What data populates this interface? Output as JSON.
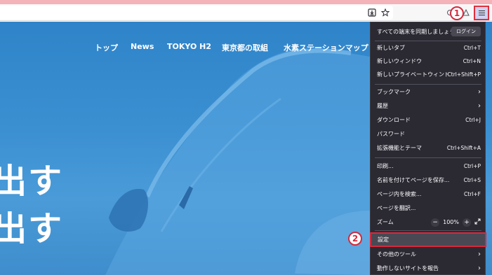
{
  "toolbar": {
    "download_icon": "download-icon",
    "bookmark_icon": "star-icon",
    "menu_icon": "hamburger-menu-icon"
  },
  "markers": {
    "one": "1",
    "two": "2"
  },
  "site_nav": {
    "items": [
      "トップ",
      "News",
      "TOKYO H2",
      "東京都の取組",
      "水素ステーションマップ"
    ]
  },
  "hero": {
    "line1": "出す",
    "line2": "出す"
  },
  "menu": {
    "sync_label": "すべての端末を同期しましょう",
    "sync_button": "ログイン",
    "new_tab": "新しいタブ",
    "new_tab_shortcut": "Ctrl+T",
    "new_window": "新しいウィンドウ",
    "new_window_shortcut": "Ctrl+N",
    "new_private": "新しいプライベートウィンドウ",
    "new_private_shortcut": "Ctrl+Shift+P",
    "bookmarks": "ブックマーク",
    "history": "履歴",
    "downloads": "ダウンロード",
    "downloads_shortcut": "Ctrl+J",
    "passwords": "パスワード",
    "addons": "拡張機能とテーマ",
    "addons_shortcut": "Ctrl+Shift+A",
    "print": "印刷...",
    "print_shortcut": "Ctrl+P",
    "save_page": "名前を付けてページを保存...",
    "save_page_shortcut": "Ctrl+S",
    "find": "ページ内を検索...",
    "find_shortcut": "Ctrl+F",
    "translate": "ページを翻訳...",
    "zoom": "ズーム",
    "zoom_minus": "−",
    "zoom_value": "100%",
    "zoom_plus": "+",
    "settings": "設定",
    "more_tools": "その他のツール",
    "report_site": "動作しないサイトを報告",
    "arrow": "›"
  },
  "colors": {
    "menu_bg": "#2b2a33",
    "highlight_red": "#d42a3c",
    "hero_blue": "#3a8fd1"
  }
}
